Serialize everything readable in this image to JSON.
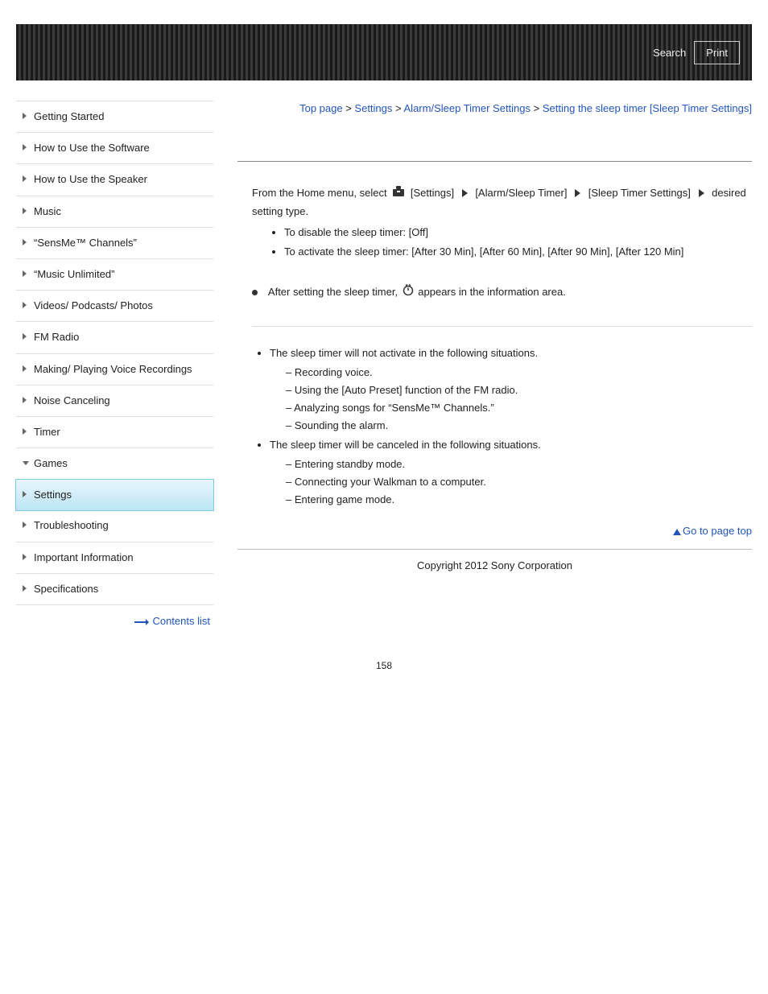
{
  "header": {
    "search": "Search",
    "print": "Print"
  },
  "sidebar": {
    "items": [
      {
        "label": "Getting Started"
      },
      {
        "label": "How to Use the Software"
      },
      {
        "label": "How to Use the Speaker"
      },
      {
        "label": "Music"
      },
      {
        "label": "“SensMe™ Channels”"
      },
      {
        "label": "“Music Unlimited”"
      },
      {
        "label": "Videos/ Podcasts/ Photos"
      },
      {
        "label": "FM Radio"
      },
      {
        "label": "Making/ Playing Voice Recordings"
      },
      {
        "label": "Noise Canceling"
      },
      {
        "label": "Timer"
      },
      {
        "label": "Games"
      },
      {
        "label": "Settings"
      },
      {
        "label": "Troubleshooting"
      },
      {
        "label": "Important Information"
      },
      {
        "label": "Specifications"
      }
    ],
    "contents_list": "Contents list"
  },
  "breadcrumb": {
    "top": "Top page",
    "settings": "Settings",
    "alarm": "Alarm/Sleep Timer Settings",
    "current": "Setting the sleep timer [Sleep Timer Settings]",
    "sep": " > "
  },
  "content": {
    "intro_pre": "From the Home menu, select ",
    "step1": "[Settings]",
    "step2": "[Alarm/Sleep Timer]",
    "step3": "[Sleep Timer Settings]",
    "step4": " desired setting type.",
    "options": [
      "To disable the sleep timer: [Off]",
      "To activate the sleep timer: [After 30 Min], [After 60 Min], [After 90 Min], [After 120 Min]"
    ],
    "hint_pre": "After setting the sleep timer, ",
    "hint_post": "appears in the information area.",
    "notes": [
      {
        "lead": "The sleep timer will not activate in the following situations.",
        "subs": [
          "Recording voice.",
          "Using the [Auto Preset] function of the FM radio.",
          "Analyzing songs for “SensMe™ Channels.”",
          "Sounding the alarm."
        ]
      },
      {
        "lead": "The sleep timer will be canceled in the following situations.",
        "subs": [
          "Entering standby mode.",
          "Connecting your Walkman to a computer.",
          "Entering game mode."
        ]
      }
    ]
  },
  "go_top": "Go to page top",
  "copyright": "Copyright 2012 Sony Corporation",
  "page_num": "158"
}
